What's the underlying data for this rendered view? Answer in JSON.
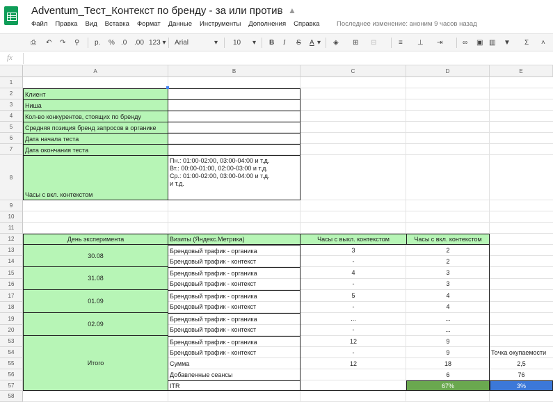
{
  "app": {
    "title": "Adventum_Тест_Контекст по бренду - за или против",
    "last_edit": "Последнее изменение: аноним 9 часов назад",
    "menu": [
      "Файл",
      "Правка",
      "Вид",
      "Вставка",
      "Формат",
      "Данные",
      "Инструменты",
      "Дополнения",
      "Справка"
    ]
  },
  "toolbar": {
    "currency": "р.",
    "percent": "%",
    "dec_less": ".0",
    "dec_more": ".00",
    "format_more": "123 ▾",
    "font": "Arial",
    "font_size": "10",
    "bold": "B",
    "italic": "I",
    "strike": "S",
    "text_color": "A"
  },
  "formula_bar": {
    "icon": "fx",
    "value": ""
  },
  "columns": [
    "A",
    "B",
    "C",
    "D",
    "E"
  ],
  "rows": [
    "1",
    "2",
    "3",
    "4",
    "5",
    "6",
    "7",
    "8",
    "9",
    "10",
    "11",
    "12",
    "13",
    "14",
    "15",
    "16",
    "17",
    "18",
    "19",
    "20",
    "53",
    "54",
    "55",
    "56",
    "57",
    "58"
  ],
  "cells": {
    "client": "Клиент",
    "niche": "Ниша",
    "competitors": "Кол-во конкурентов, стоящих по бренду",
    "avg_position": "Средняя позиция бренд запросов в органике",
    "test_start": "Дата начала теста",
    "test_end": "Дата окончания теста",
    "hours_label": "Часы с вкл. контекстом",
    "hours_value": "Пн.: 01:00-02:00, 03:00-04:00 и т.д.\nВт.:  00:00-01:00, 02:00-03:00 и т.д.\nСр.: 01:00-02:00, 03:00-04:00 и т.д.\nи т.д.",
    "hdr_day": "День эксперимента",
    "hdr_visits": "Визиты (Яндекс.Метрика)",
    "hdr_off": "Часы с выкл. контекстом",
    "hdr_on": "Часы с вкл. контекстом",
    "d1": "30.08",
    "d2": "31.08",
    "d3": "01.09",
    "d4": "02.09",
    "organic": "Брендовый трафик - органика",
    "context": "Брендовый трафик - контекст",
    "r13c": "3",
    "r13d": "2",
    "r14c": "-",
    "r14d": "2",
    "r15c": "4",
    "r15d": "3",
    "r16c": "-",
    "r16d": "3",
    "r17c": "5",
    "r17d": "4",
    "r18c": "-",
    "r18d": "4",
    "r19c": "...",
    "r19d": "...",
    "r20c": "-",
    "r20d": "...",
    "total": "Итого",
    "r53c": "12",
    "r53d": "9",
    "r54c": "-",
    "r54d": "9",
    "r54e": "Точка окупаемости",
    "sum": "Сумма",
    "r55c": "12",
    "r55d": "18",
    "r55e": "2,5",
    "added": "Добавленные сеансы",
    "r56d": "6",
    "r56e": "76",
    "itr": "ITR",
    "r57d": "67%",
    "r57e": "3%"
  }
}
